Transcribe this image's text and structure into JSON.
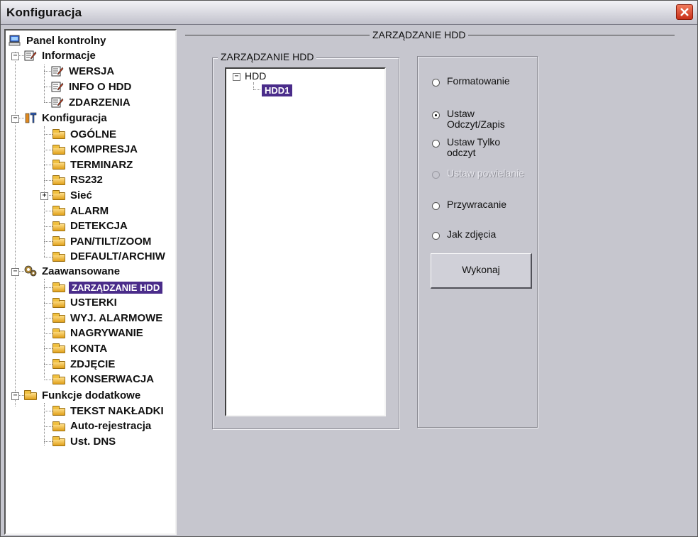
{
  "window": {
    "title": "Konfiguracja"
  },
  "sidebar": {
    "root": "Panel kontrolny",
    "informacje": {
      "label": "Informacje",
      "items": [
        "WERSJA",
        "INFO O HDD",
        "ZDARZENIA"
      ]
    },
    "konfiguracja": {
      "label": "Konfiguracja",
      "items": [
        "OGÓLNE",
        "KOMPRESJA",
        "TERMINARZ",
        "RS232",
        "Sieć",
        "ALARM",
        "DETEKCJA",
        "PAN/TILT/ZOOM",
        "DEFAULT/ARCHIW"
      ]
    },
    "zaawansowane": {
      "label": "Zaawansowane",
      "items": [
        "ZARZĄDZANIE HDD",
        "USTERKI",
        "WYJ. ALARMOWE",
        "NAGRYWANIE",
        "KONTA",
        "ZDJĘCIE",
        "KONSERWACJA"
      ]
    },
    "funkcje": {
      "label": "Funkcje dodatkowe",
      "items": [
        "TEKST NAKŁADKI",
        "Auto-rejestracja",
        "Ust. DNS"
      ]
    }
  },
  "main": {
    "section_title": "ZARZĄDZANIE HDD",
    "tree_group_title": "ZARZĄDZANIE HDD",
    "tree": {
      "root": "HDD",
      "child": "HDD1"
    },
    "options": [
      {
        "label": "Formatowanie",
        "checked": false,
        "disabled": false
      },
      {
        "label": "Ustaw Odczyt/Zapis",
        "checked": true,
        "disabled": false
      },
      {
        "label": "Ustaw Tylko odczyt",
        "checked": false,
        "disabled": false
      },
      {
        "label": "Ustaw powielanie",
        "checked": false,
        "disabled": true
      },
      {
        "label": "Przywracanie",
        "checked": false,
        "disabled": false
      },
      {
        "label": "Jak zdjęcia",
        "checked": false,
        "disabled": false
      }
    ],
    "execute_label": "Wykonaj"
  },
  "colors": {
    "selection": "#4a2c8a",
    "close": "#d84424"
  }
}
